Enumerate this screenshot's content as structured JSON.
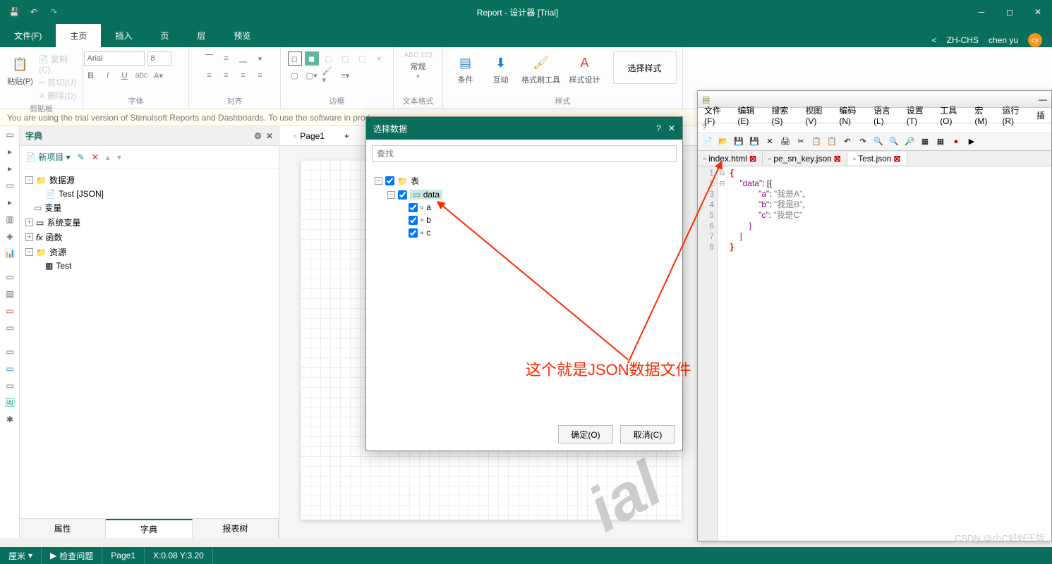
{
  "title": "Report - 设计器 [Trial]",
  "qat": {
    "save": "💾",
    "undo": "↶",
    "redo": "↷"
  },
  "tabs": {
    "file": "文件(F)",
    "home": "主页",
    "insert": "插入",
    "page": "页",
    "layer": "层",
    "preview": "预览"
  },
  "topRight": {
    "lang": "ZH-CHS",
    "user": "chen yu",
    "avatar": "cy"
  },
  "ribbon": {
    "clipboard": {
      "paste": "粘贴(P)",
      "copy": "复制(C)",
      "cut": "剪切(U)",
      "delete": "删除(D)",
      "label": "剪贴板"
    },
    "font": {
      "name": "Arial",
      "size": "8",
      "label": "字体"
    },
    "align": {
      "label": "对齐"
    },
    "border": {
      "label": "边框"
    },
    "textfmt": {
      "tf1": "ABC 123",
      "tf2": "常规",
      "label": "文本格式"
    },
    "style": {
      "cond": "条件",
      "interact": "互动",
      "brush": "格式刷工具",
      "designer": "样式设计",
      "select": "选择样式",
      "label": "样式"
    }
  },
  "banner": "You are using the trial version of Stimulsoft Reports and Dashboards. To use the software in produ",
  "dict": {
    "title": "字典",
    "newItem": "新项目",
    "tree": {
      "ds": "数据源",
      "test": "Test [JSON]",
      "vars": "变量",
      "sysvars": "系统变量",
      "funcs": "函数",
      "res": "资源",
      "testRes": "Test"
    },
    "tabs": {
      "props": "属性",
      "dict": "字典",
      "reporttree": "报表树"
    }
  },
  "pageTab": "Page1",
  "dialog": {
    "title": "选择数据",
    "searchPlaceholder": "查找",
    "tree": {
      "tables": "表",
      "data": "data",
      "a": "a",
      "b": "b",
      "c": "c"
    },
    "ok": "确定(O)",
    "cancel": "取消(C)"
  },
  "annotation": "这个就是JSON数据文件",
  "editor": {
    "menus": [
      "文件(F)",
      "编辑(E)",
      "搜索(S)",
      "视图(V)",
      "编码(N)",
      "语言(L)",
      "设置(T)",
      "工具(O)",
      "宏(M)",
      "运行(R)",
      "插"
    ],
    "q": "?",
    "tabs": [
      {
        "name": "index.html",
        "active": false
      },
      {
        "name": "pe_sn_key.json",
        "active": false
      },
      {
        "name": "Test.json",
        "active": true
      }
    ],
    "code": {
      "l1_key": "\"data\"",
      "l1_rest": ": [{",
      "l2_key": "\"a\"",
      "l2_val": "\"我是A\"",
      "l3_key": "\"b\"",
      "l3_val": "\"我是B\"",
      "l4_key": "\"c\"",
      "l4_val": "\"我是C\"",
      "l5": "}",
      "l6": "]",
      "l7": "}"
    }
  },
  "status": {
    "unit": "厘米",
    "check": "检查问题",
    "page": "Page1",
    "coord": "X:0.08 Y:3.20"
  },
  "csdn": "CSDN @小C好好干饭"
}
